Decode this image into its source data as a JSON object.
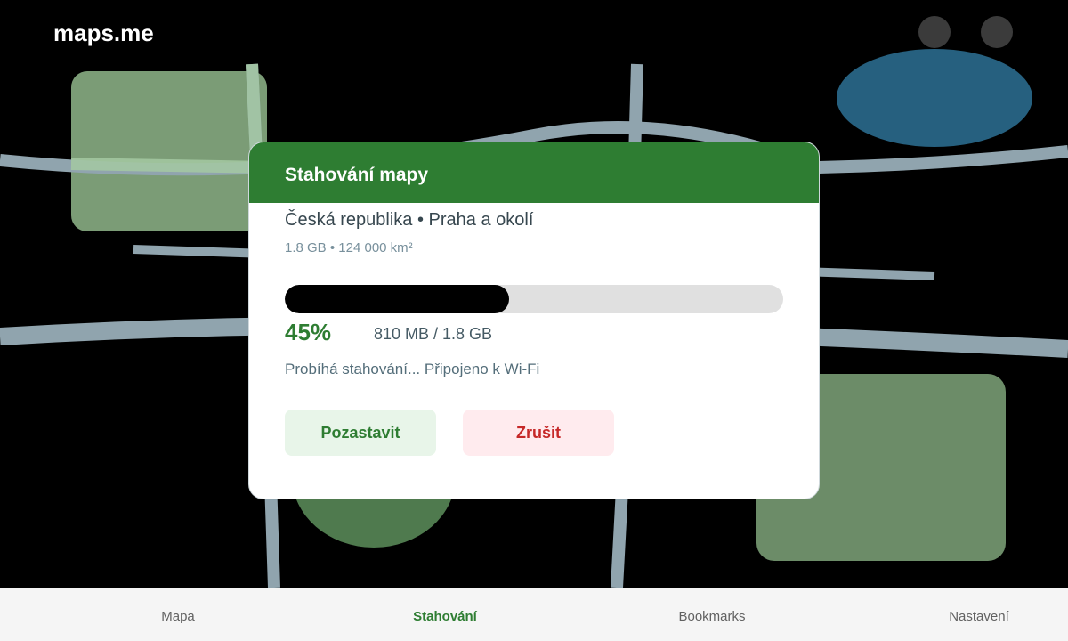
{
  "app": {
    "title": "maps.me"
  },
  "dialog": {
    "title": "Stahování mapy",
    "region": "Česká republika • Praha a okolí",
    "meta": "1.8 GB • 124 000 km²",
    "progress": {
      "value": 0.45,
      "percent_label": "45%",
      "size_label": "810 MB / 1.8 GB"
    },
    "status": "Probíhá stahování... Připojeno k Wi-Fi",
    "pause_label": "Pozastavit",
    "cancel_label": "Zrušit"
  },
  "nav": {
    "items": [
      {
        "label": "Mapa",
        "active": false
      },
      {
        "label": "Stahování",
        "active": true
      },
      {
        "label": "Bookmarks",
        "active": false
      },
      {
        "label": "Nastavení",
        "active": false
      }
    ]
  },
  "colors": {
    "brand_green": "#2e7d32",
    "cancel_red": "#c62828",
    "map_road": "#90a4ae",
    "map_water": "#26607f",
    "map_park": "#7d9e78"
  }
}
